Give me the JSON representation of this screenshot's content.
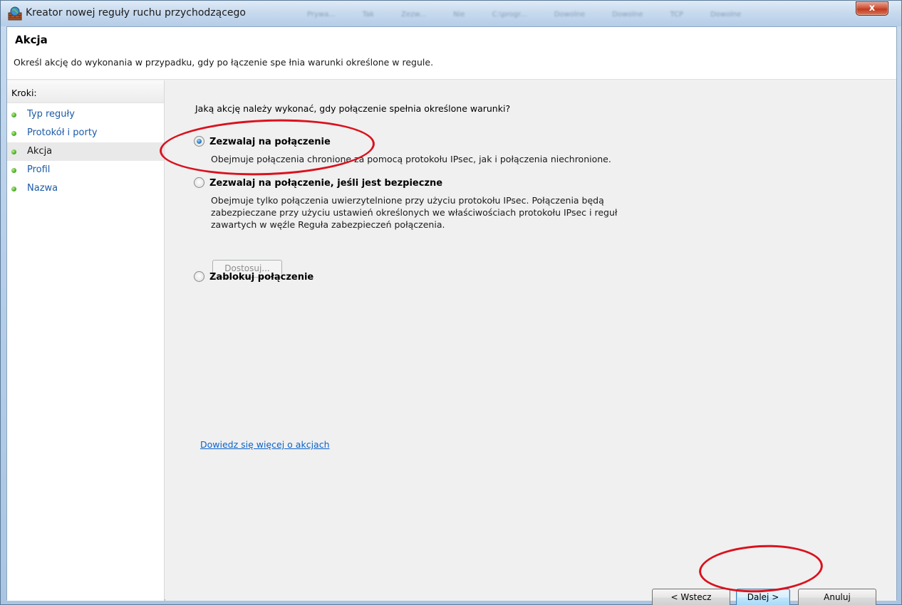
{
  "window": {
    "title": "Kreator nowej reguły ruchu przychodzącego",
    "close_label": "x",
    "background_columns": [
      "Prywa...",
      "Tak",
      "Zezw...",
      "Nie",
      "C:\\progr...",
      "Dowolne",
      "Dowolne",
      "TCP",
      "Dowolne"
    ]
  },
  "header": {
    "title": "Akcja",
    "description": "Określ akcję do wykonania w przypadku, gdy po łączenie spe łnia warunki określone w regule."
  },
  "steps": {
    "heading": "Kroki:",
    "items": [
      {
        "label": "Typ reguły",
        "state": "done"
      },
      {
        "label": "Protokół i porty",
        "state": "done"
      },
      {
        "label": "Akcja",
        "state": "current"
      },
      {
        "label": "Profil",
        "state": "pending"
      },
      {
        "label": "Nazwa",
        "state": "pending"
      }
    ]
  },
  "main": {
    "question": "Jaką akcję należy wykonać, gdy połączenie spełnia określone warunki?",
    "options": [
      {
        "label": "Zezwalaj na połączenie",
        "checked": true,
        "description": "Obejmuje połączenia chronione za pomocą protokołu IPsec, jak i połączenia niechronione."
      },
      {
        "label": "Zezwalaj na połączenie, jeśli jest bezpieczne",
        "checked": false,
        "description_lines": [
          "Obejmuje tylko połączenia uwierzytelnione przy użyciu protokołu IPsec. Połączenia będą",
          "zabezpieczane przy użyciu ustawień określonych we właściwościach protokołu IPsec i reguł",
          "zawartych w węźle Reguła zabezpieczeń połączenia."
        ]
      },
      {
        "label": "Zablokuj połączenie",
        "checked": false
      }
    ],
    "customize_button": "Dostosuj...",
    "learn_more_link": "Dowiedz się więcej o akcjach"
  },
  "footer": {
    "back_button": "< Wstecz",
    "next_button": "Dalej >",
    "cancel_button": "Anuluj"
  },
  "colors": {
    "link": "#0b63c9",
    "step_link": "#1c5aa8",
    "annotation": "#d9121e",
    "step_dot": "#4caf28"
  }
}
